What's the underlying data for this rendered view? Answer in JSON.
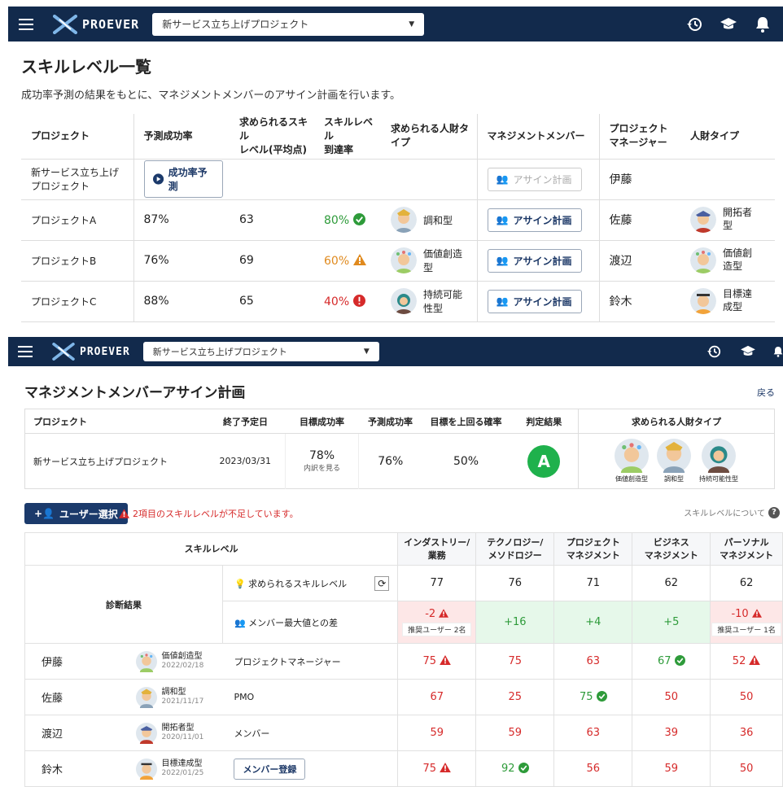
{
  "app": {
    "brand": "PROEVER",
    "project_select": "新サービス立ち上げプロジェクト"
  },
  "screen1": {
    "title": "スキルレベル一覧",
    "subtitle": "成功率予測の結果をもとに、マネジメントメンバーのアサイン計画を行います。",
    "headers": [
      "プロジェクト",
      "予測成功率",
      "求められるスキルレベル(平均点)",
      "スキルレベル到達率",
      "求められる人財タイプ",
      "マネジメントメンバー",
      "プロジェクトマネージャー",
      "人財タイプ"
    ],
    "header_lines": {
      "skill": [
        "求められるスキル",
        "レベル(平均点)"
      ],
      "reach": [
        "スキルレベル",
        "到達率"
      ],
      "pm": [
        "プロジェクト",
        "マネージャー"
      ]
    },
    "rows": [
      {
        "name_l1": "新サービス立ち上げ",
        "name_l2": "プロジェクト",
        "predict_button": "成功率予測",
        "assign": "アサイン計画",
        "pm": "伊藤"
      },
      {
        "name": "プロジェクトA",
        "rate": "87%",
        "skill": "63",
        "reach": "80%",
        "type": "調和型",
        "assign": "アサイン計画",
        "pm": "佐藤",
        "pmtype_l1": "開拓者",
        "pmtype_l2": "型"
      },
      {
        "name": "プロジェクトB",
        "rate": "76%",
        "skill": "69",
        "reach": "60%",
        "type": "価値創造型",
        "assign": "アサイン計画",
        "pm": "渡辺",
        "pmtype_l1": "価値創",
        "pmtype_l2": "造型"
      },
      {
        "name": "プロジェクトC",
        "rate": "88%",
        "skill": "65",
        "reach": "40%",
        "type": "持続可能性型",
        "assign": "アサイン計画",
        "pm": "鈴木",
        "pmtype_l1": "目標達",
        "pmtype_l2": "成型"
      }
    ]
  },
  "screen2": {
    "title": "マネジメントメンバーアサイン計画",
    "back": "戻る",
    "info_headers": [
      "プロジェクト",
      "終了予定日",
      "目標成功率",
      "予測成功率",
      "目標を上回る確率",
      "判定結果",
      "求められる人財タイプ"
    ],
    "info": {
      "project": "新サービス立ち上げプロジェクト",
      "end": "2023/03/31",
      "target": "78%",
      "target_link": "内訳を見る",
      "predict": "76%",
      "prob": "50%",
      "grade": "A",
      "types": [
        "価値創造型",
        "調和型",
        "持続可能性型"
      ]
    },
    "user_select": "ユーザー選択",
    "warning": "2項目のスキルレベルが不足しています。",
    "skill_about": "スキルレベルについて",
    "skill_header": "スキルレベル",
    "columns": [
      [
        "インダストリー/",
        "業務"
      ],
      [
        "テクノロジー/",
        "メソドロジー"
      ],
      [
        "プロジェクト",
        "マネジメント"
      ],
      [
        "ビジネス",
        "マネジメント"
      ],
      [
        "パーソナル",
        "マネジメント"
      ]
    ],
    "diag_label": "診断結果",
    "req_label": "求められるスキルレベル",
    "diff_label": "メンバー最大値との差",
    "required": [
      "77",
      "76",
      "71",
      "62",
      "62"
    ],
    "diff": [
      "-2",
      "+16",
      "+4",
      "+5",
      "-10"
    ],
    "diff_notes": [
      "推奨ユーザー 2名",
      "",
      "",
      "",
      "推奨ユーザー 1名"
    ],
    "members": [
      {
        "name": "伊藤",
        "type": "価値創造型",
        "date": "2022/02/18",
        "role": "プロジェクトマネージャー",
        "scores": [
          "75",
          "75",
          "63",
          "67",
          "52"
        ]
      },
      {
        "name": "佐藤",
        "type": "調和型",
        "date": "2021/11/17",
        "role": "PMO",
        "scores": [
          "67",
          "25",
          "75",
          "50",
          "50"
        ]
      },
      {
        "name": "渡辺",
        "type": "開拓者型",
        "date": "2020/11/01",
        "role": "メンバー",
        "scores": [
          "59",
          "59",
          "63",
          "39",
          "36"
        ]
      },
      {
        "name": "鈴木",
        "type": "目標達成型",
        "date": "2022/01/25",
        "role": "メンバー登録",
        "scores": [
          "75",
          "92",
          "56",
          "59",
          "50"
        ]
      }
    ]
  }
}
